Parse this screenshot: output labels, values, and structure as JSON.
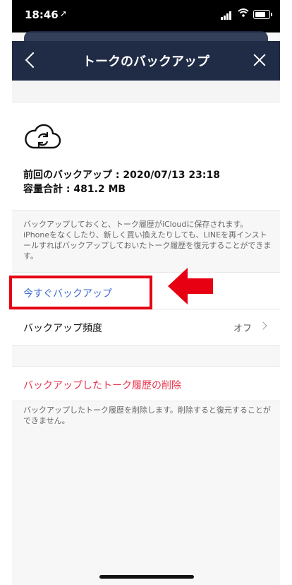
{
  "status_bar": {
    "time": "18:46",
    "location_glyph": "➚"
  },
  "nav": {
    "title": "トークのバックアップ"
  },
  "backup_info": {
    "last_backup": "前回のバックアップ : 2020/07/13 23:18",
    "capacity": "容量合計 : 481.2 MB"
  },
  "description": "バックアップしておくと、トーク履歴がiCloudに保存されます。iPhoneをなくしたり、新しく買い換えたりしても、LINEを再インストールすればバックアップしておいたトーク履歴を復元することができます。",
  "actions": {
    "backup_now": "今すぐバックアップ",
    "frequency_label": "バックアップ頻度",
    "frequency_value": "オフ",
    "delete_backup": "バックアップしたトーク履歴の削除"
  },
  "delete_description": "バックアップしたトーク履歴を削除します。削除すると復元することができません。",
  "colors": {
    "nav_bg": "#202b46",
    "link_blue": "#3f6ed0",
    "danger_red": "#e8344e",
    "highlight_red": "#e60012"
  }
}
